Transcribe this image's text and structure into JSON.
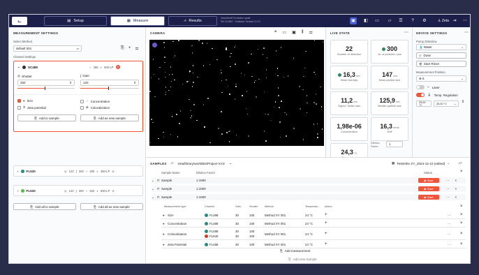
{
  "topbar": {
    "tabs": [
      {
        "label": "Setup",
        "icon": "setup-icon"
      },
      {
        "label": "Measure",
        "icon": "ruler-icon"
      },
      {
        "label": "Results",
        "icon": "chart-icon"
      }
    ],
    "version_line1": "ZetaView® Evolution quatt",
    "version_line2": "SN 23-884 · Software Version 2.0.3",
    "user": "Zeta"
  },
  "left": {
    "title": "MEASUREMENT SETTINGS",
    "select_method_label": "Select Method",
    "method_value": "default 001",
    "channel_settings_label": "Channel Settings",
    "channels": [
      {
        "name": "SC488",
        "dot": "#333",
        "laser": "488",
        "filter": "500-LP",
        "badge": "0",
        "shutter_label": "Shutter",
        "shutter": "250",
        "gain_label": "Gain",
        "gain": "120",
        "shutter_level": 0.47,
        "gain_level": 0.48,
        "options": [
          {
            "label": "Size",
            "checked": true
          },
          {
            "label": "Concentration",
            "checked": false
          },
          {
            "label": "Zeta potential",
            "checked": false
          },
          {
            "label": "Colocalization",
            "checked": false
          }
        ],
        "add_sample": "Add to sample",
        "add_new_sample": "Add as new sample"
      },
      {
        "name": "FL520",
        "dot": "#2a8a7c",
        "shutter": "120",
        "gain": "250",
        "laser": "405",
        "filter": "450-LP"
      },
      {
        "name": "FL520",
        "dot": "#55b84a",
        "shutter": "120",
        "gain": "250",
        "laser": "520",
        "filter": "550-LP"
      }
    ],
    "add_all": "Add all to sample",
    "add_all_new": "Add all as new sample"
  },
  "camera": {
    "title": "CAMERA"
  },
  "live": {
    "title": "LIVE STATE",
    "tiles": [
      {
        "v": "22",
        "u": "",
        "l": "Number of detection"
      },
      {
        "v": "300",
        "u": "",
        "l": "Nr. of particles / pos",
        "dot": "#2a8a5a"
      },
      {
        "v": "16,3",
        "u": "nm",
        "l": "Mean Intensity",
        "dot": "#2a8a5a"
      },
      {
        "v": "147",
        "u": "nm",
        "l": "Mean particle size"
      },
      {
        "v": "11,2",
        "u": "nm",
        "l": "Signal / Noise ratio"
      },
      {
        "v": "125,9",
        "u": "nm",
        "l": "Median particle size"
      },
      {
        "v": "1,98e-06",
        "u": "",
        "l": "Concentration"
      },
      {
        "v": "16,3",
        "u": "nm/s",
        "l": "Drift"
      },
      {
        "v": "24,3",
        "u": "°C",
        "l": "Temperature"
      }
    ],
    "dilution_label": "Dilution Factor",
    "dilution_value": "1"
  },
  "device": {
    "title": "DEVICE SETTINGS",
    "pump_label": "Pump ZetaView",
    "pump_value": "Water",
    "dose": "Dose",
    "start_rinse": "Start Rinse",
    "position_label": "Measurement Position",
    "position_value": "5",
    "laser": "Laser",
    "temp_reg": "Temp. Regulation",
    "temp1": "25,00 °C",
    "temp2": "25,00 °C"
  },
  "samples": {
    "title": "SAMPLES",
    "path": "zeta/library/worklists/Project-XYZ",
    "worklist": "Testreihe XY_2024-12-10 (edited)",
    "col_name": "Sample Name",
    "col_dilution": "Dilution Factor",
    "col_status": "Status",
    "rows": [
      {
        "name": "Sample",
        "dilution": "1:1000",
        "start": "Start"
      },
      {
        "name": "Sample",
        "dilution": "1:1000",
        "start": "Start"
      },
      {
        "name": "Sample",
        "dilution": "1:1000",
        "start": "Start"
      }
    ],
    "sub_cols": [
      "Measurement type",
      "Channel",
      "Gain",
      "Shutter",
      "Method",
      "Temperatu...",
      "Action"
    ],
    "sub_rows": [
      {
        "type": "Size",
        "icon": "size-icon",
        "channels": [
          {
            "n": "FL488",
            "c": "#2a8a7c"
          }
        ],
        "gain": [
          "30"
        ],
        "shutter": [
          "100"
        ],
        "method": "Method XY 001",
        "temp": "24 °C"
      },
      {
        "type": "Concentration",
        "icon": "concentration-icon",
        "channels": [
          {
            "n": "FL488",
            "c": "#2a8a7c"
          }
        ],
        "gain": [
          "30"
        ],
        "shutter": [
          "100"
        ],
        "method": "Method XY 001",
        "temp": "24 °C"
      },
      {
        "type": "Colocalization",
        "icon": "coloc-icon",
        "channels": [
          {
            "n": "FL488",
            "c": "#2a8a7c"
          },
          {
            "n": "FL640",
            "c": "#d63a2a"
          }
        ],
        "gain": [
          "30",
          "30"
        ],
        "shutter": [
          "100",
          "100"
        ],
        "method": "Method XY 001",
        "temp": "24 °C"
      },
      {
        "type": "Zeta Potential",
        "icon": "zeta-icon",
        "channels": [
          {
            "n": "FL488",
            "c": "#2a8a7c"
          }
        ],
        "gain": [
          "30"
        ],
        "shutter": [
          "100"
        ],
        "method": "Method XY 001",
        "temp": "24 °C"
      }
    ],
    "add_measurement": "Add measurement",
    "add_sample": "Add new Sample"
  }
}
